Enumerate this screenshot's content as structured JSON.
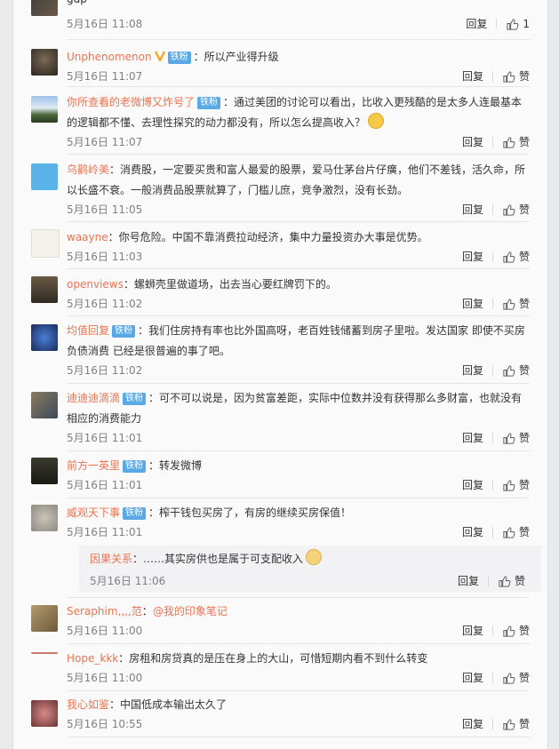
{
  "labels": {
    "reply": "回复",
    "like": "赞",
    "badge": "铁粉"
  },
  "top_item": {
    "text": "gdp",
    "time": "5月16日 11:08",
    "likes": "1"
  },
  "comments": [
    {
      "user": "Unphenomenon",
      "badge": true,
      "verified": true,
      "sep": "：",
      "text": "所以产业得升级",
      "time": "5月16日 11:07"
    },
    {
      "user": "你所查看的老微博又炸号了",
      "badge": true,
      "sep": "：",
      "text": "通过美团的讨论可以看出，比收入更残酷的是太多人连最基本的逻辑都不懂、去理性探究的动力都没有，所以怎么提高收入？",
      "time": "5月16日 11:07"
    },
    {
      "user": "乌鹳岭美",
      "badge": false,
      "sep": "：",
      "text": "消费股，一定要买贵和富人最爱的股票，爱马仕茅台片仔癀，他们不差钱，活久命，所以长盛不衰。一般消费品股票就算了，门槛儿庶，竞争激烈，没有长劲。",
      "time": "5月16日 11:05"
    },
    {
      "user": "waayne",
      "badge": false,
      "sep": "：",
      "text": "你号危险。中国不靠消费拉动经济，集中力量投资办大事是优势。",
      "time": "5月16日 11:03"
    },
    {
      "user": "openviews",
      "badge": false,
      "sep": "：",
      "text": "螺蛳壳里做道场，出去当心要红牌罚下的。",
      "time": "5月16日 11:02"
    },
    {
      "user": "均值回复",
      "badge": true,
      "sep": "：",
      "text": "我们住房持有率也比外国高呀，老百姓钱储蓄到房子里啦。发达国家 即使不买房 负债消费 已经是很普遍的事了吧。",
      "time": "5月16日 11:02"
    },
    {
      "user": "迪迪迪滴滴",
      "badge": true,
      "sep": "：",
      "text": "可不可以说是，因为贫富差距，实际中位数并没有获得那么多财富，也就没有相应的消费能力",
      "time": "5月16日 11:01"
    },
    {
      "user": "前方一英里",
      "badge": true,
      "sep": "：",
      "text": "转发微博",
      "time": "5月16日 11:01"
    },
    {
      "user": "威观天下事",
      "badge": true,
      "sep": "：",
      "text": "榨干钱包买房了，有房的继续买房保值！",
      "time": "5月16日 11:01"
    },
    {
      "user": "Seraphim,,,,范",
      "badge": false,
      "sep": "：",
      "text": "@我的印象笔记",
      "time": "5月16日 11:00"
    },
    {
      "user": "Hope_kkk",
      "badge": false,
      "sep": "：",
      "text": "房租和房贷真的是压在身上的大山，可惜短期内看不到什么转变",
      "time": "5月16日 11:00"
    },
    {
      "user": "我心如鉴",
      "badge": false,
      "sep": "：",
      "text": "中国低成本输出太久了",
      "time": "5月16日 10:55"
    }
  ],
  "sub_reply": {
    "user": "因果关系",
    "sep": "：",
    "text": "……其实房供也是属于可支配收入",
    "time": "5月16日 11:06"
  },
  "colors": {
    "username": "#eb7350",
    "badge": "#5aa8e6",
    "time": "#808080"
  }
}
